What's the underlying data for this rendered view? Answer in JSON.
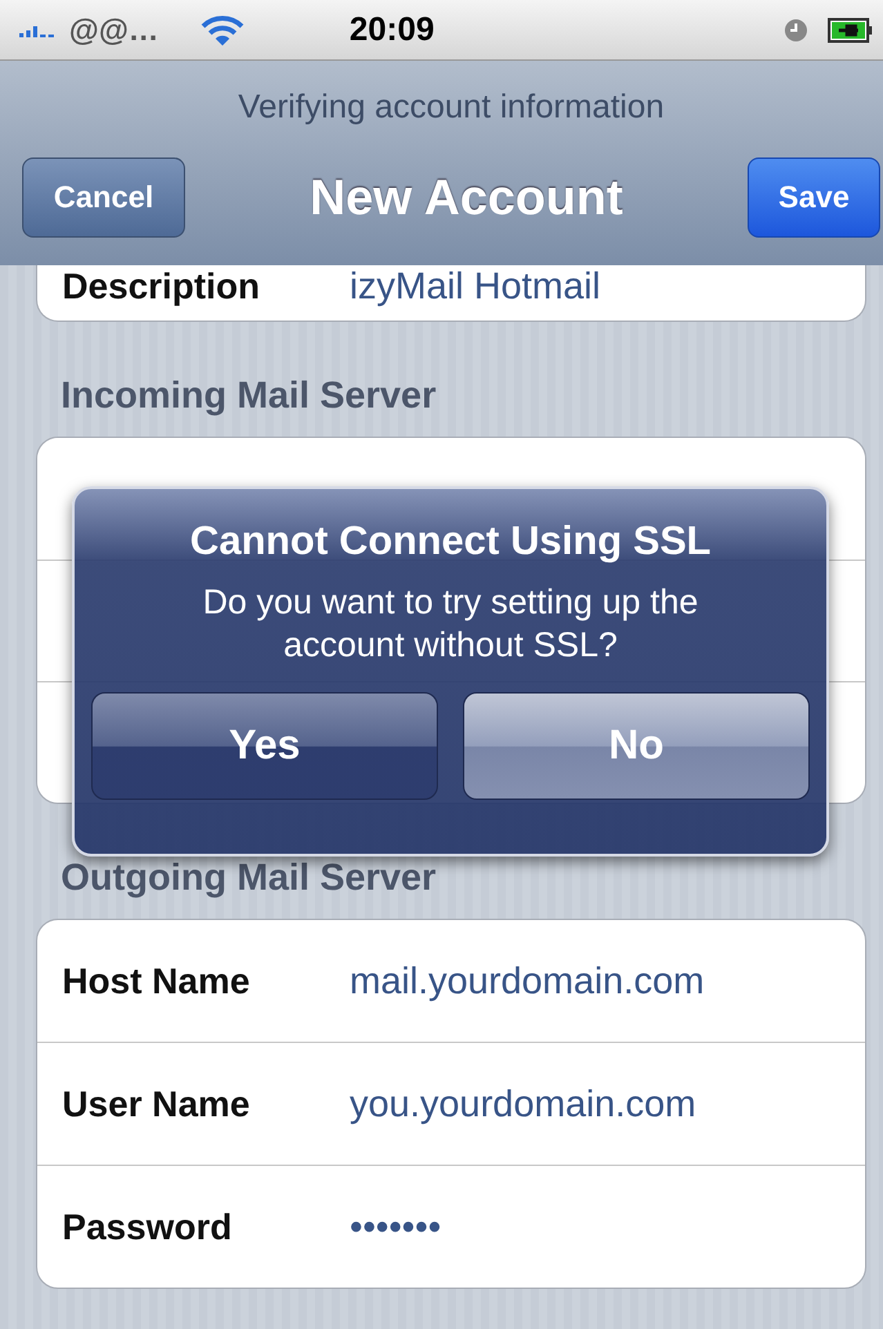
{
  "status_bar": {
    "carrier": "@@…",
    "time": "20:09"
  },
  "nav": {
    "prompt": "Verifying account information",
    "title": "New Account",
    "buttons": [
      {
        "label": "Cancel",
        "kind": "plain"
      },
      {
        "label": "Save",
        "kind": "done"
      }
    ]
  },
  "sections": [
    {
      "rows": [
        {
          "label": "Description",
          "value": "izyMail Hotmail"
        }
      ]
    },
    {
      "header": "Incoming Mail Server"
    },
    {
      "header": "Outgoing Mail Server",
      "rows": [
        {
          "label": "Host Name",
          "value": "mail.yourdomain.com"
        },
        {
          "label": "User Name",
          "value": "you.yourdomain.com"
        },
        {
          "label": "Password",
          "value": "•••••••"
        }
      ]
    }
  ],
  "alert": {
    "title": "Cannot Connect Using SSL",
    "message": "Do you want to try setting up the account without SSL?",
    "buttons": [
      {
        "label": "Yes",
        "kind": "cancel"
      },
      {
        "label": "No",
        "kind": "default"
      }
    ]
  }
}
